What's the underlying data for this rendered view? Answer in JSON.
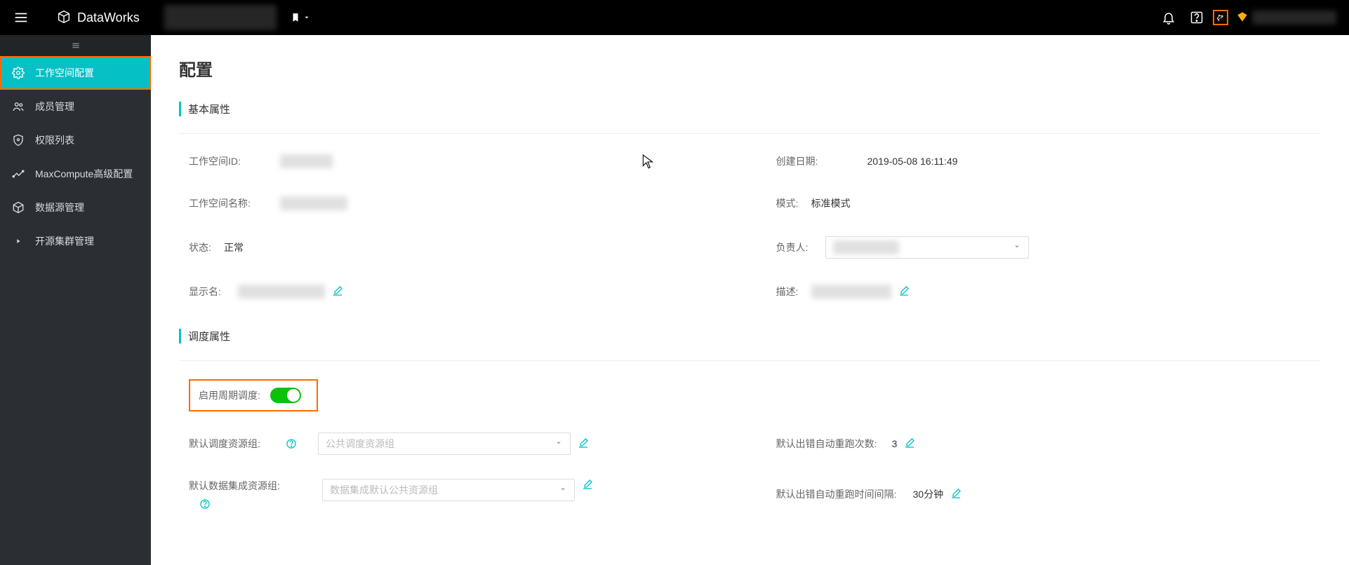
{
  "header": {
    "product": "DataWorks"
  },
  "sidebar": {
    "items": [
      {
        "key": "workspace-config",
        "label": "工作空间配置",
        "icon": "gear"
      },
      {
        "key": "member-mgmt",
        "label": "成员管理",
        "icon": "users"
      },
      {
        "key": "permission-list",
        "label": "权限列表",
        "icon": "shield"
      },
      {
        "key": "mc-adv-config",
        "label": "MaxCompute高级配置",
        "icon": "path"
      },
      {
        "key": "datasource-mgmt",
        "label": "数据源管理",
        "icon": "cube"
      },
      {
        "key": "oss-cluster-mgmt",
        "label": "开源集群管理",
        "icon": "caret"
      }
    ]
  },
  "page": {
    "title": "配置"
  },
  "basic": {
    "heading": "基本属性",
    "workspace_id_label": "工作空间ID:",
    "create_time_label": "创建日期:",
    "create_time_value": "2019-05-08 16:11:49",
    "workspace_name_label": "工作空间名称:",
    "mode_label": "模式:",
    "mode_value": "标准模式",
    "status_label": "状态:",
    "status_value": "正常",
    "owner_label": "负责人:",
    "display_name_label": "显示名:",
    "description_label": "描述:"
  },
  "schedule": {
    "heading": "调度属性",
    "enable_periodic_label": "启用周期调度:",
    "default_sched_res_label": "默认调度资源组:",
    "default_sched_res_placeholder": "公共调度资源组",
    "retry_count_label": "默认出错自动重跑次数:",
    "retry_count_value": "3",
    "default_di_res_label": "默认数据集成资源组:",
    "default_di_res_placeholder": "数据集成默认公共资源组",
    "retry_interval_label": "默认出错自动重跑时间间隔:",
    "retry_interval_value": "30分钟"
  }
}
